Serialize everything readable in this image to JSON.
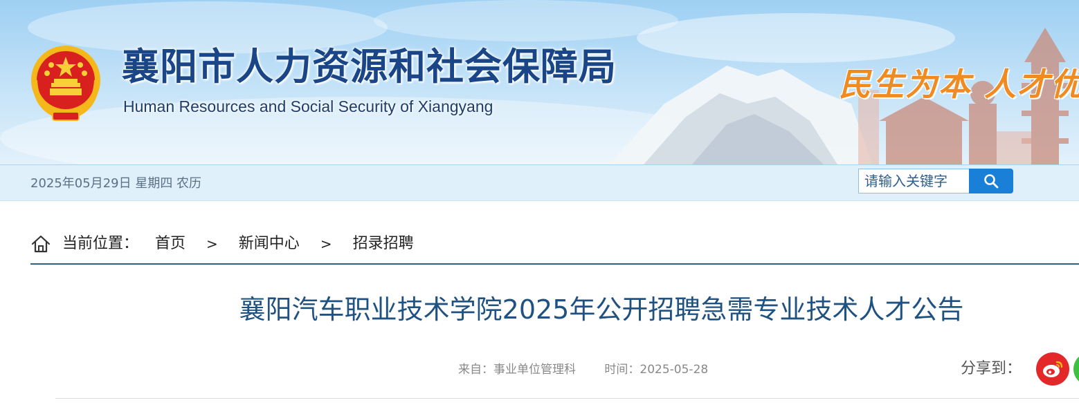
{
  "header": {
    "title": "襄阳市人力资源和社会保障局",
    "subtitle": "Human Resources and Social Security of Xiangyang",
    "slogan": "民生为本 人才优先",
    "emblem_icon": "national-emblem-icon"
  },
  "infobar": {
    "date": "2025年05月29日 星期四 农历"
  },
  "search": {
    "placeholder": "请输入关键字",
    "button_icon": "search-icon"
  },
  "breadcrumb": {
    "icon": "home-icon",
    "prefix": "当前位置：",
    "items": [
      "首页",
      "新闻中心",
      "招录招聘"
    ],
    "separator": ">"
  },
  "article": {
    "title": "襄阳汽车职业技术学院2025年公开招聘急需专业技术人才公告",
    "source": "来自：事业单位管理科",
    "time": "时间：2025-05-28"
  },
  "share": {
    "label": "分享到：",
    "targets": [
      "weibo-icon",
      "wechat-icon"
    ]
  },
  "colors": {
    "title_blue": "#1a4688",
    "accent_orange": "#f08b22",
    "search_button": "#1a7fd7",
    "article_title": "#1f5281",
    "weibo_red": "#e4282a",
    "wechat_green": "#3ec13e"
  }
}
